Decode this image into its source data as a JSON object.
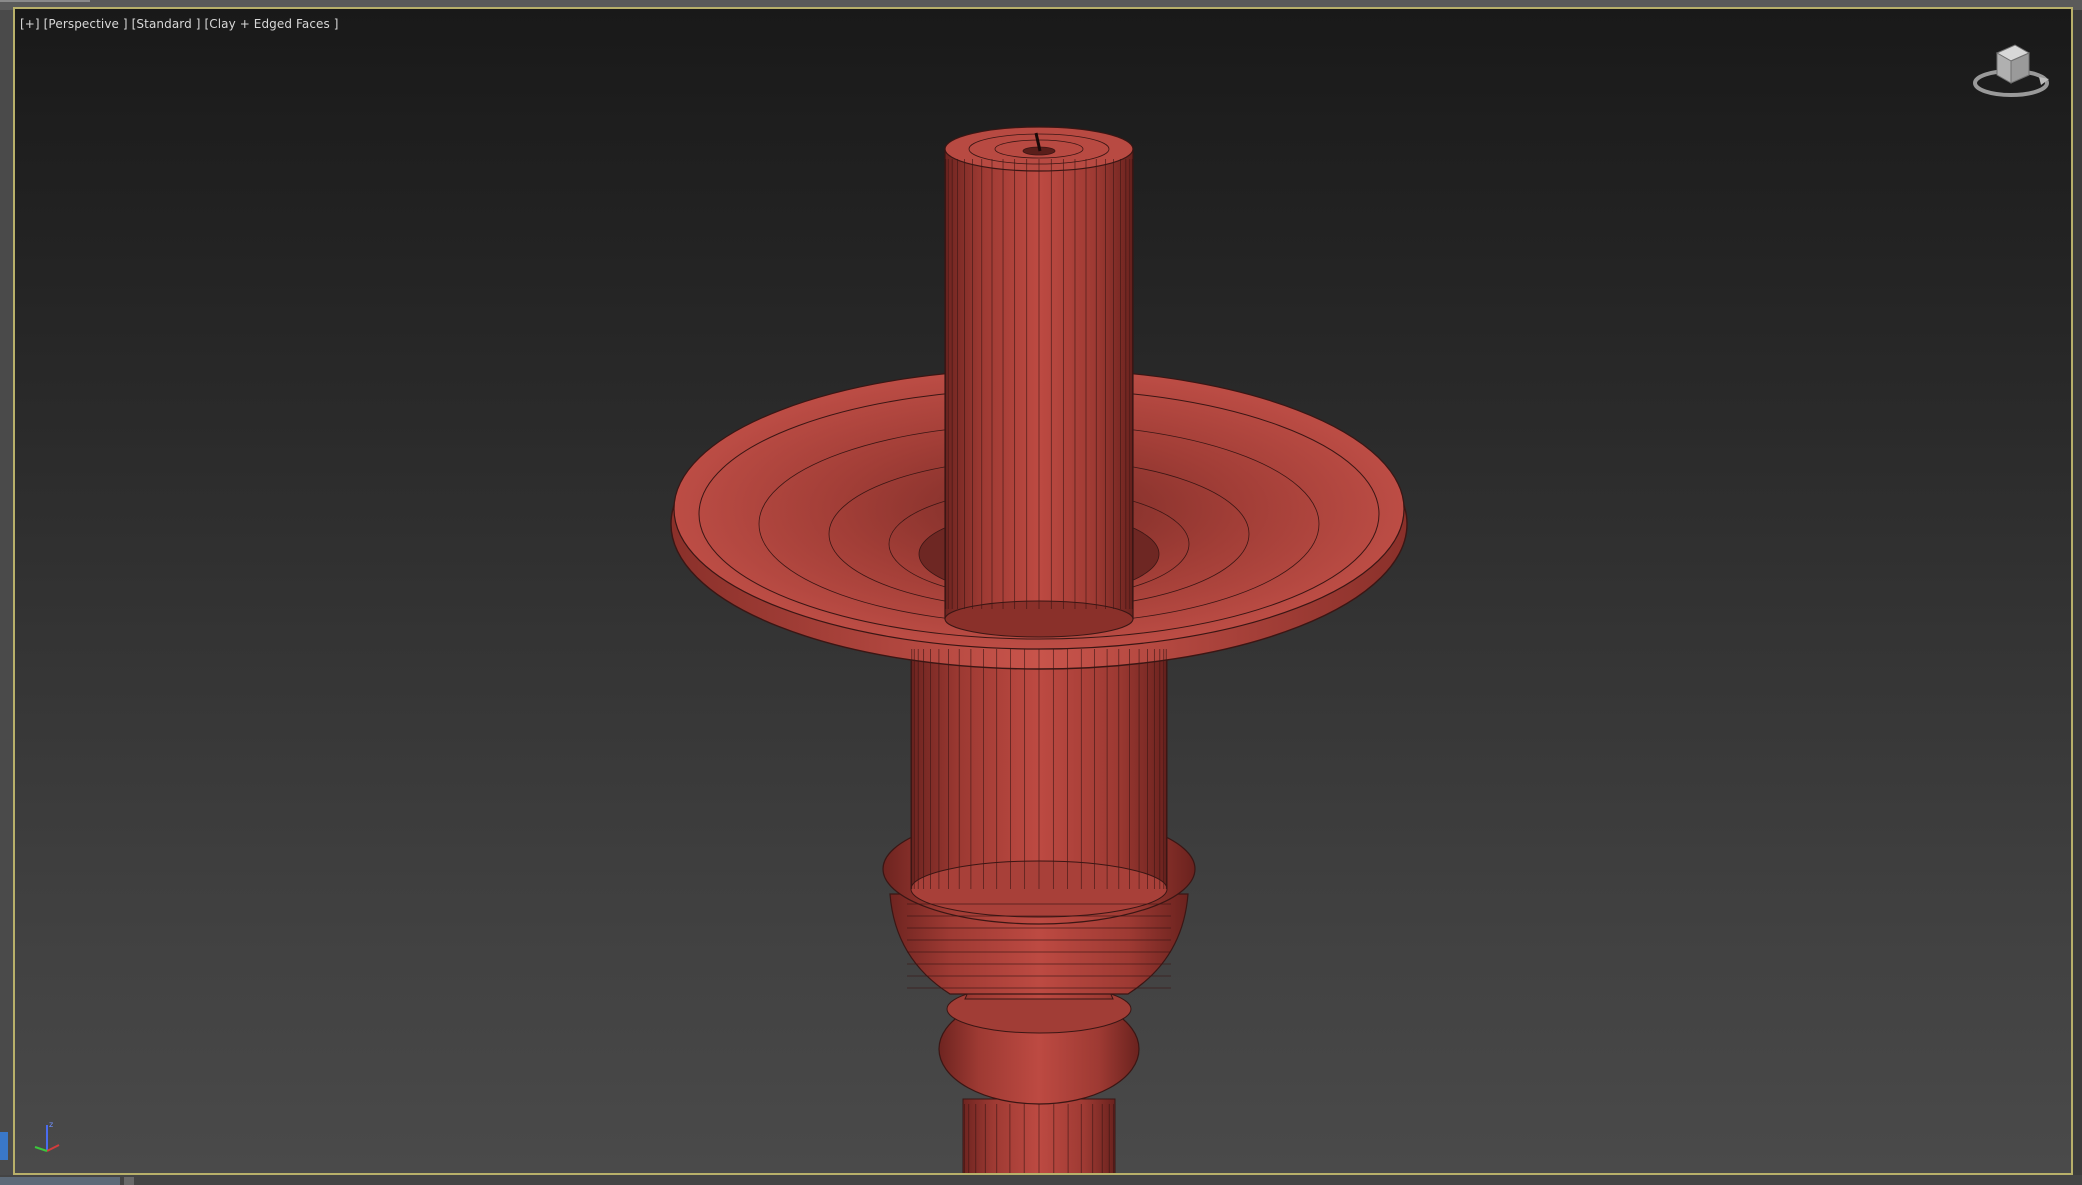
{
  "viewport": {
    "label": {
      "plus": "[+]",
      "view": "[Perspective ]",
      "shading_standard": "[Standard ]",
      "shading_mode": "[Clay + Edged Faces ]"
    },
    "viewcube": {
      "icon": "viewcube-icon"
    },
    "axis_tripod": {
      "icon": "axis-tripod-icon",
      "z_label": "z"
    }
  },
  "colors": {
    "model_clay": "#b8473f",
    "model_edge": "#3a1614",
    "viewport_border": "#b8b06a",
    "axis_x": "#d23c3c",
    "axis_y": "#3cc83c",
    "axis_z": "#4a6cf0"
  }
}
